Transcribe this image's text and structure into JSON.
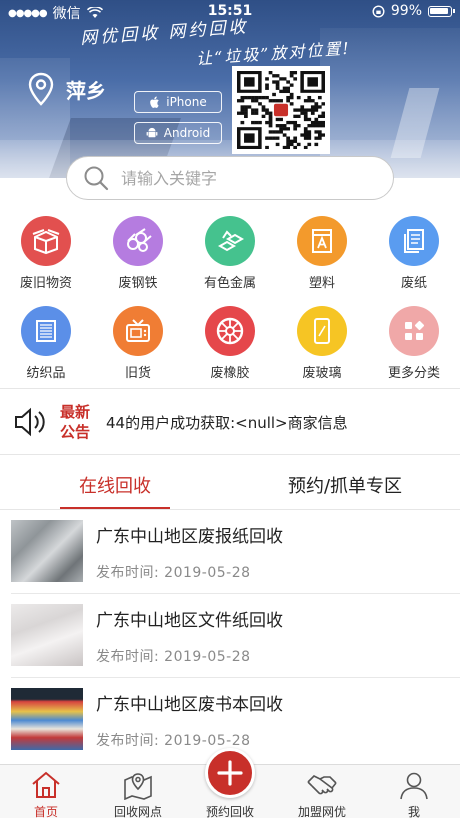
{
  "status_bar": {
    "carrier": "微信",
    "time": "15:51",
    "battery": "99%"
  },
  "banner": {
    "slogan_line1": "网优回收   网约回收",
    "slogan_line2": "让“垃圾”放对位置!",
    "city": "萍乡",
    "iphone_label": "iPhone",
    "android_label": "Android"
  },
  "search": {
    "placeholder": "请输入关键字"
  },
  "categories": [
    {
      "label": "废旧物资",
      "color": "#e2504f",
      "icon": "box-icon"
    },
    {
      "label": "废钢铁",
      "color": "#b57ce0",
      "icon": "steel-pipes-icon"
    },
    {
      "label": "有色金属",
      "color": "#45c28e",
      "icon": "metal-ingots-icon"
    },
    {
      "label": "塑料",
      "color": "#f39a2c",
      "icon": "plastic-icon"
    },
    {
      "label": "废纸",
      "color": "#5a9cf0",
      "icon": "paper-icon"
    },
    {
      "label": "纺织品",
      "color": "#5b8fe8",
      "icon": "textile-icon"
    },
    {
      "label": "旧货",
      "color": "#f07d34",
      "icon": "tv-icon"
    },
    {
      "label": "废橡胶",
      "color": "#e5474b",
      "icon": "tire-icon"
    },
    {
      "label": "废玻璃",
      "color": "#f6c524",
      "icon": "glass-icon"
    },
    {
      "label": "更多分类",
      "color": "#f0a8a8",
      "icon": "more-categories-icon"
    }
  ],
  "notice": {
    "badge_line1": "最新",
    "badge_line2": "公告",
    "message": "44的用户成功获取:<null>商家信息"
  },
  "tabs": [
    {
      "label": "在线回收",
      "active": true
    },
    {
      "label": "预约/抓单专区",
      "active": false
    }
  ],
  "listings": [
    {
      "title": "广东中山地区废报纸回收",
      "date": "发布时间: 2019-05-28"
    },
    {
      "title": "广东中山地区文件纸回收",
      "date": "发布时间: 2019-05-28"
    },
    {
      "title": "广东中山地区废书本回收",
      "date": "发布时间: 2019-05-28"
    }
  ],
  "bottom_nav": [
    {
      "label": "首页",
      "icon": "home-icon",
      "active": true
    },
    {
      "label": "回收网点",
      "icon": "map-pin-icon",
      "active": false
    },
    {
      "label": "预约回收",
      "icon": "plus-icon",
      "active": false
    },
    {
      "label": "加盟网优",
      "icon": "handshake-icon",
      "active": false
    },
    {
      "label": "我",
      "icon": "user-icon",
      "active": false
    }
  ],
  "colors": {
    "accent": "#c8302a",
    "banner": "#4a6da8"
  }
}
